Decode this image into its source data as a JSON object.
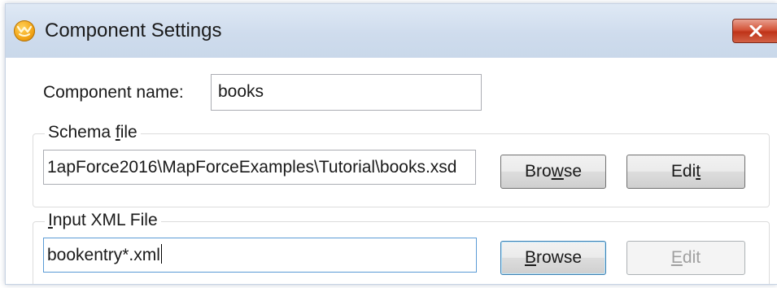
{
  "window": {
    "title": "Component Settings",
    "close_icon": "close-icon",
    "app_icon": "mapforce-app-icon"
  },
  "component": {
    "name_label": "Component name:",
    "name_value": "books"
  },
  "schema": {
    "group_label_pre": "Schema ",
    "group_label_accel": "f",
    "group_label_post": "ile",
    "path_value": "1apForce2016\\MapForceExamples\\Tutorial\\books.xsd",
    "browse_pre": "Bro",
    "browse_accel": "w",
    "browse_post": "se",
    "edit_pre": "Edi",
    "edit_accel": "t",
    "edit_post": ""
  },
  "input_xml": {
    "group_label_pre": "",
    "group_label_accel": "I",
    "group_label_post": "nput XML File",
    "path_value": "bookentry*.xml",
    "browse_pre": "",
    "browse_accel": "B",
    "browse_post": "rowse",
    "edit_pre": "",
    "edit_accel": "E",
    "edit_post": "dit",
    "edit_enabled": false
  },
  "colors": {
    "titlebar": "#cfdced",
    "close_button": "#c7432a",
    "focus_border": "#5b9bd5"
  }
}
